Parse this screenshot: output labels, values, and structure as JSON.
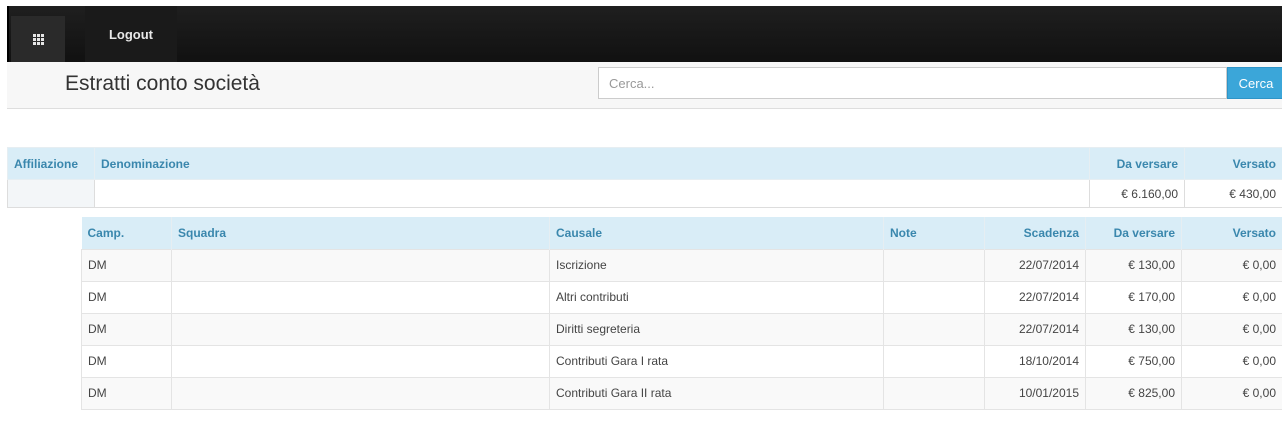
{
  "navbar": {
    "grid_icon": "apps-grid-icon",
    "logout_label": "Logout"
  },
  "header": {
    "title": "Estratti conto società",
    "search_placeholder": "Cerca...",
    "search_button_label": "Cerca"
  },
  "summary_table": {
    "columns": {
      "affiliazione": "Affiliazione",
      "denominazione": "Denominazione",
      "da_versare": "Da versare",
      "versato": "Versato"
    },
    "row": {
      "affiliazione": "",
      "denominazione": "",
      "da_versare": "€ 6.160,00",
      "versato": "€ 430,00"
    }
  },
  "detail_table": {
    "columns": {
      "camp": "Camp.",
      "squadra": "Squadra",
      "causale": "Causale",
      "note": "Note",
      "scadenza": "Scadenza",
      "da_versare": "Da versare",
      "versato": "Versato"
    },
    "rows": [
      {
        "camp": "DM",
        "squadra": "",
        "causale": "Iscrizione",
        "note": "",
        "scadenza": "22/07/2014",
        "da_versare": "€ 130,00",
        "versato": "€ 0,00"
      },
      {
        "camp": "DM",
        "squadra": "",
        "causale": "Altri contributi",
        "note": "",
        "scadenza": "22/07/2014",
        "da_versare": "€ 170,00",
        "versato": "€ 0,00"
      },
      {
        "camp": "DM",
        "squadra": "",
        "causale": "Diritti segreteria",
        "note": "",
        "scadenza": "22/07/2014",
        "da_versare": "€ 130,00",
        "versato": "€ 0,00"
      },
      {
        "camp": "DM",
        "squadra": "",
        "causale": "Contributi Gara I rata",
        "note": "",
        "scadenza": "18/10/2014",
        "da_versare": "€ 750,00",
        "versato": "€ 0,00"
      },
      {
        "camp": "DM",
        "squadra": "",
        "causale": "Contributi Gara II rata",
        "note": "",
        "scadenza": "10/01/2015",
        "da_versare": "€ 825,00",
        "versato": "€ 0,00"
      }
    ]
  }
}
